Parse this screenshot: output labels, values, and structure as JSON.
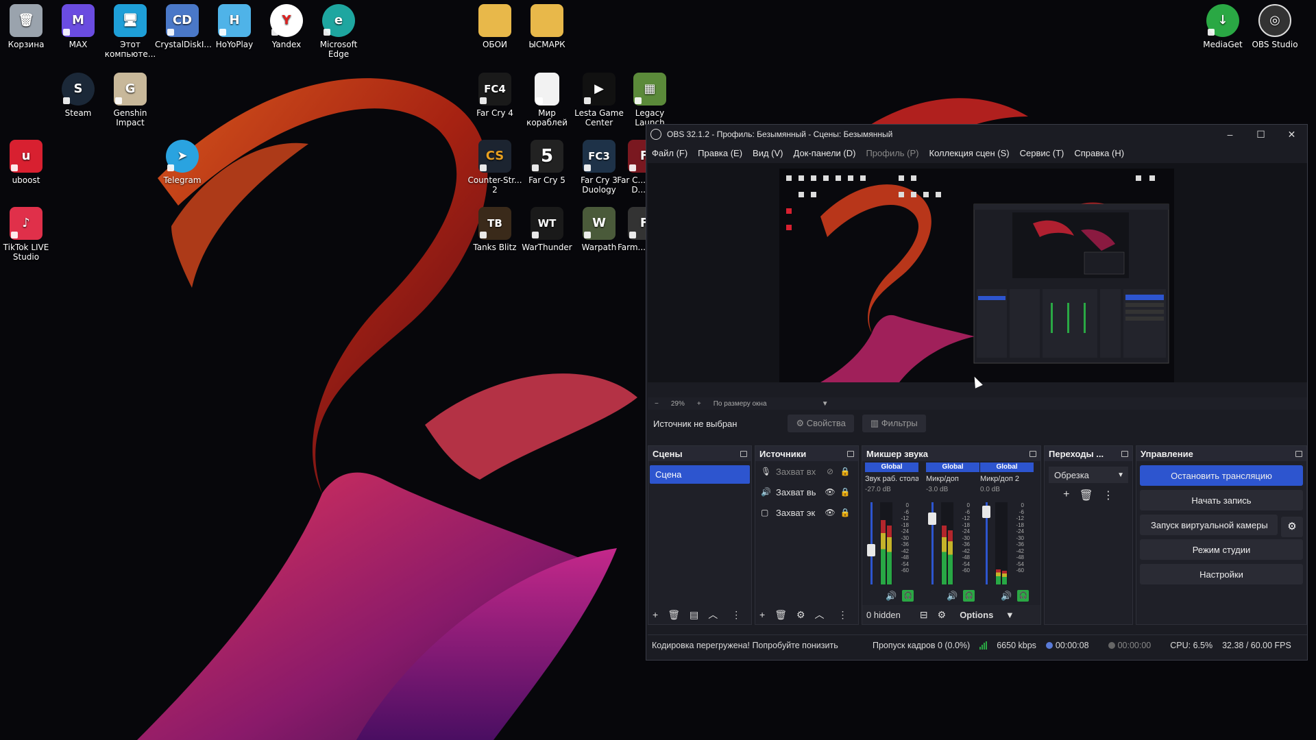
{
  "desktop": {
    "icons": [
      {
        "label": "Корзина",
        "icon": "recycle-bin-icon",
        "color": "#9aa3ad",
        "glyph": "🗑"
      },
      {
        "label": "MAX",
        "icon": "max-icon",
        "color": "#6a4ce0",
        "glyph": "M"
      },
      {
        "label": "Этот компьюте...",
        "icon": "this-pc-icon",
        "color": "#1e9fd8",
        "glyph": "🖥"
      },
      {
        "label": "CrystalDiskI...",
        "icon": "crystaldisk-icon",
        "color": "#4a78c8",
        "glyph": "CD"
      },
      {
        "label": "HoYoPlay",
        "icon": "hoyoplay-icon",
        "color": "#4fb3e8",
        "glyph": "H"
      },
      {
        "label": "Yandex",
        "icon": "yandex-icon",
        "color": "#ffffff",
        "glyph": "Y"
      },
      {
        "label": "Microsoft Edge",
        "icon": "edge-icon",
        "color": "#1ea6a0",
        "glyph": "e"
      },
      {
        "label": "ОБОИ",
        "icon": "folder-icon",
        "color": "#e8b84a",
        "glyph": "📁"
      },
      {
        "label": "ЫСМАРК",
        "icon": "folder-icon",
        "color": "#e8b84a",
        "glyph": "📁"
      },
      {
        "label": "MediaGet",
        "icon": "mediaget-icon",
        "color": "#2aa844",
        "glyph": "↓"
      },
      {
        "label": "OBS Studio",
        "icon": "obs-studio-icon",
        "color": "#333333",
        "glyph": "◎"
      },
      {
        "label": "Steam",
        "icon": "steam-icon",
        "color": "#1b2838",
        "glyph": "S"
      },
      {
        "label": "Genshin Impact",
        "icon": "genshin-icon",
        "color": "#c8b89a",
        "glyph": "G"
      },
      {
        "label": "Far Cry 4",
        "icon": "farcry4-icon",
        "color": "#1a1a1a",
        "glyph": "FC4"
      },
      {
        "label": "Мир кораблей",
        "icon": "document-icon",
        "color": "#f2f2f2",
        "glyph": ""
      },
      {
        "label": "Lesta Game Center",
        "icon": "lesta-icon",
        "color": "#111111",
        "glyph": "▶"
      },
      {
        "label": "Legacy Launch",
        "icon": "minecraft-icon",
        "color": "#5b8a3a",
        "glyph": "▦"
      },
      {
        "label": "uboost",
        "icon": "uboost-icon",
        "color": "#d82030",
        "glyph": "u"
      },
      {
        "label": "Telegram",
        "icon": "telegram-icon",
        "color": "#2aa3e0",
        "glyph": "➤"
      },
      {
        "label": "Counter-Str... 2",
        "icon": "cs2-icon",
        "color": "#1c2430",
        "glyph": "CS"
      },
      {
        "label": "Far Cry 5",
        "icon": "farcry5-icon",
        "color": "#222222",
        "glyph": "5"
      },
      {
        "label": "Far Cry 3 Duology",
        "icon": "farcry3-icon",
        "color": "#1e3248",
        "glyph": "FC3"
      },
      {
        "label": "Far C... D...",
        "icon": "farcry-icon",
        "color": "#7a1820",
        "glyph": "F"
      },
      {
        "label": "TikTok LIVE Studio",
        "icon": "tiktok-icon",
        "color": "#e0304a",
        "glyph": "♪"
      },
      {
        "label": "Tanks Blitz",
        "icon": "tanks-blitz-icon",
        "color": "#3a2a1a",
        "glyph": "TB"
      },
      {
        "label": "WarThunder",
        "icon": "warthunder-icon",
        "color": "#1a1a1a",
        "glyph": "WT"
      },
      {
        "label": "Warpath",
        "icon": "warpath-icon",
        "color": "#4a5a3a",
        "glyph": "W"
      },
      {
        "label": "Farm...",
        "icon": "farming-icon",
        "color": "#333333",
        "glyph": "F"
      }
    ]
  },
  "obs": {
    "title": "OBS 32.1.2 - Профиль: Безымянный - Сцены: Безымянный",
    "window_controls": {
      "minimize": "–",
      "maximize": "☐",
      "close": "✕"
    },
    "menu": [
      "Файл (F)",
      "Правка (E)",
      "Вид (V)",
      "Док-панели (D)",
      "Профиль (P)",
      "Коллекция сцен (S)",
      "Сервис (T)",
      "Справка (H)"
    ],
    "zoom": {
      "minus": "−",
      "value": "29%",
      "plus": "+",
      "mode": "По размеру окна"
    },
    "source_bar": {
      "label": "Источник не выбран",
      "properties": "Свойства",
      "filters": "Фильтры"
    },
    "scenes": {
      "title": "Сцены",
      "items": [
        "Сцена"
      ]
    },
    "sources": {
      "title": "Источники",
      "items": [
        {
          "name": "Захват вх",
          "icon": "🎙",
          "visible": false
        },
        {
          "name": "Захват вь",
          "icon": "🔊",
          "visible": true
        },
        {
          "name": "Захват эк",
          "icon": "▢",
          "visible": true
        }
      ]
    },
    "mixer": {
      "title": "Микшер звука",
      "channels": [
        {
          "badge": "Global",
          "name": "Звук раб. стола",
          "db": "-27.0 dB",
          "level": 0.78,
          "fader": 0.4
        },
        {
          "badge": "Global",
          "name": "Микр/доп",
          "db": "-3.0 dB",
          "level": 0.72,
          "fader": 0.85
        },
        {
          "badge": "Global",
          "name": "Микр/доп 2",
          "db": "0.0 dB",
          "level": 0.18,
          "fader": 0.95
        }
      ],
      "scale": [
        "0",
        "-6",
        "-12",
        "-18",
        "-24",
        "-30",
        "-36",
        "-42",
        "-48",
        "-54",
        "-60"
      ],
      "footer": {
        "hidden": "0 hidden",
        "options": "Options"
      }
    },
    "transitions": {
      "title": "Переходы ...",
      "selected": "Обрезка"
    },
    "controls": {
      "title": "Управление",
      "stop_stream": "Остановить трансляцию",
      "start_record": "Начать запись",
      "virtual_cam": "Запуск виртуальной камеры",
      "studio_mode": "Режим студии",
      "settings": "Настройки"
    },
    "status": {
      "warning": "Кодировка перегружена! Попробуйте понизить",
      "dropped": "Пропуск кадров 0 (0.0%)",
      "bitrate": "6650 kbps",
      "stream_time": "00:00:08",
      "record_time": "00:00:00",
      "cpu": "CPU: 6.5%",
      "fps": "32.38 / 60.00 FPS"
    }
  }
}
